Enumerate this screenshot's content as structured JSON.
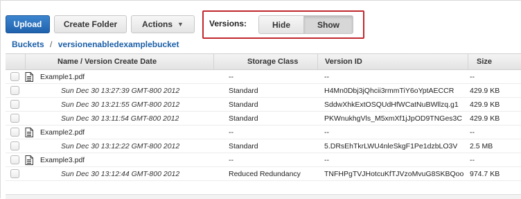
{
  "toolbar": {
    "upload_label": "Upload",
    "create_folder_label": "Create Folder",
    "actions_label": "Actions"
  },
  "versions": {
    "label": "Versions:",
    "hide_label": "Hide",
    "show_label": "Show",
    "selected": "Show",
    "highlight_color": "#c0272d"
  },
  "breadcrumb": {
    "root": "Buckets",
    "separator": "/",
    "bucket": "versionenabledexamplebucket"
  },
  "table": {
    "columns": [
      "Name / Version Create Date",
      "Storage Class",
      "Version ID",
      "Size"
    ],
    "rows": [
      {
        "kind": "file",
        "name": "Example1.pdf",
        "storage": "--",
        "version_id": "--",
        "size": "--"
      },
      {
        "kind": "version",
        "name": "Sun Dec 30 13:27:39 GMT-800 2012",
        "storage": "Standard",
        "version_id": "H4Mn0Dbj3jQhcii3rmmTiY6oYptAECCR",
        "size": "429.9 KB"
      },
      {
        "kind": "version",
        "name": "Sun Dec 30 13:21:55 GMT-800 2012",
        "storage": "Standard",
        "version_id": "SddwXhkExtOSQUdHfWCatNuBWllzq.g1",
        "size": "429.9 KB"
      },
      {
        "kind": "version",
        "name": "Sun Dec 30 13:11:54 GMT-800 2012",
        "storage": "Standard",
        "version_id": "PKWnukhgVls_M5xmXf1jJpOD9TNGes3C",
        "size": "429.9 KB"
      },
      {
        "kind": "file",
        "name": "Example2.pdf",
        "storage": "--",
        "version_id": "--",
        "size": "--"
      },
      {
        "kind": "version",
        "name": "Sun Dec 30 13:12:22 GMT-800 2012",
        "storage": "Standard",
        "version_id": "5.DRsEhTkrLWU4nleSkgF1Pe1dzbLO3V",
        "size": "2.5 MB"
      },
      {
        "kind": "file",
        "name": "Example3.pdf",
        "storage": "--",
        "version_id": "--",
        "size": "--"
      },
      {
        "kind": "version",
        "name": "Sun Dec 30 13:12:44 GMT-800 2012",
        "storage": "Reduced Redundancy",
        "version_id": "TNFHPgTVJHotcuKfTJVzoMvuG8SKBQoo",
        "size": "974.7 KB"
      }
    ]
  },
  "icons": {
    "file_row": "document-icon",
    "actions_caret": "chevron-down-icon"
  },
  "colors": {
    "primary_button": "#1f62ad",
    "link": "#1b5fa8"
  }
}
